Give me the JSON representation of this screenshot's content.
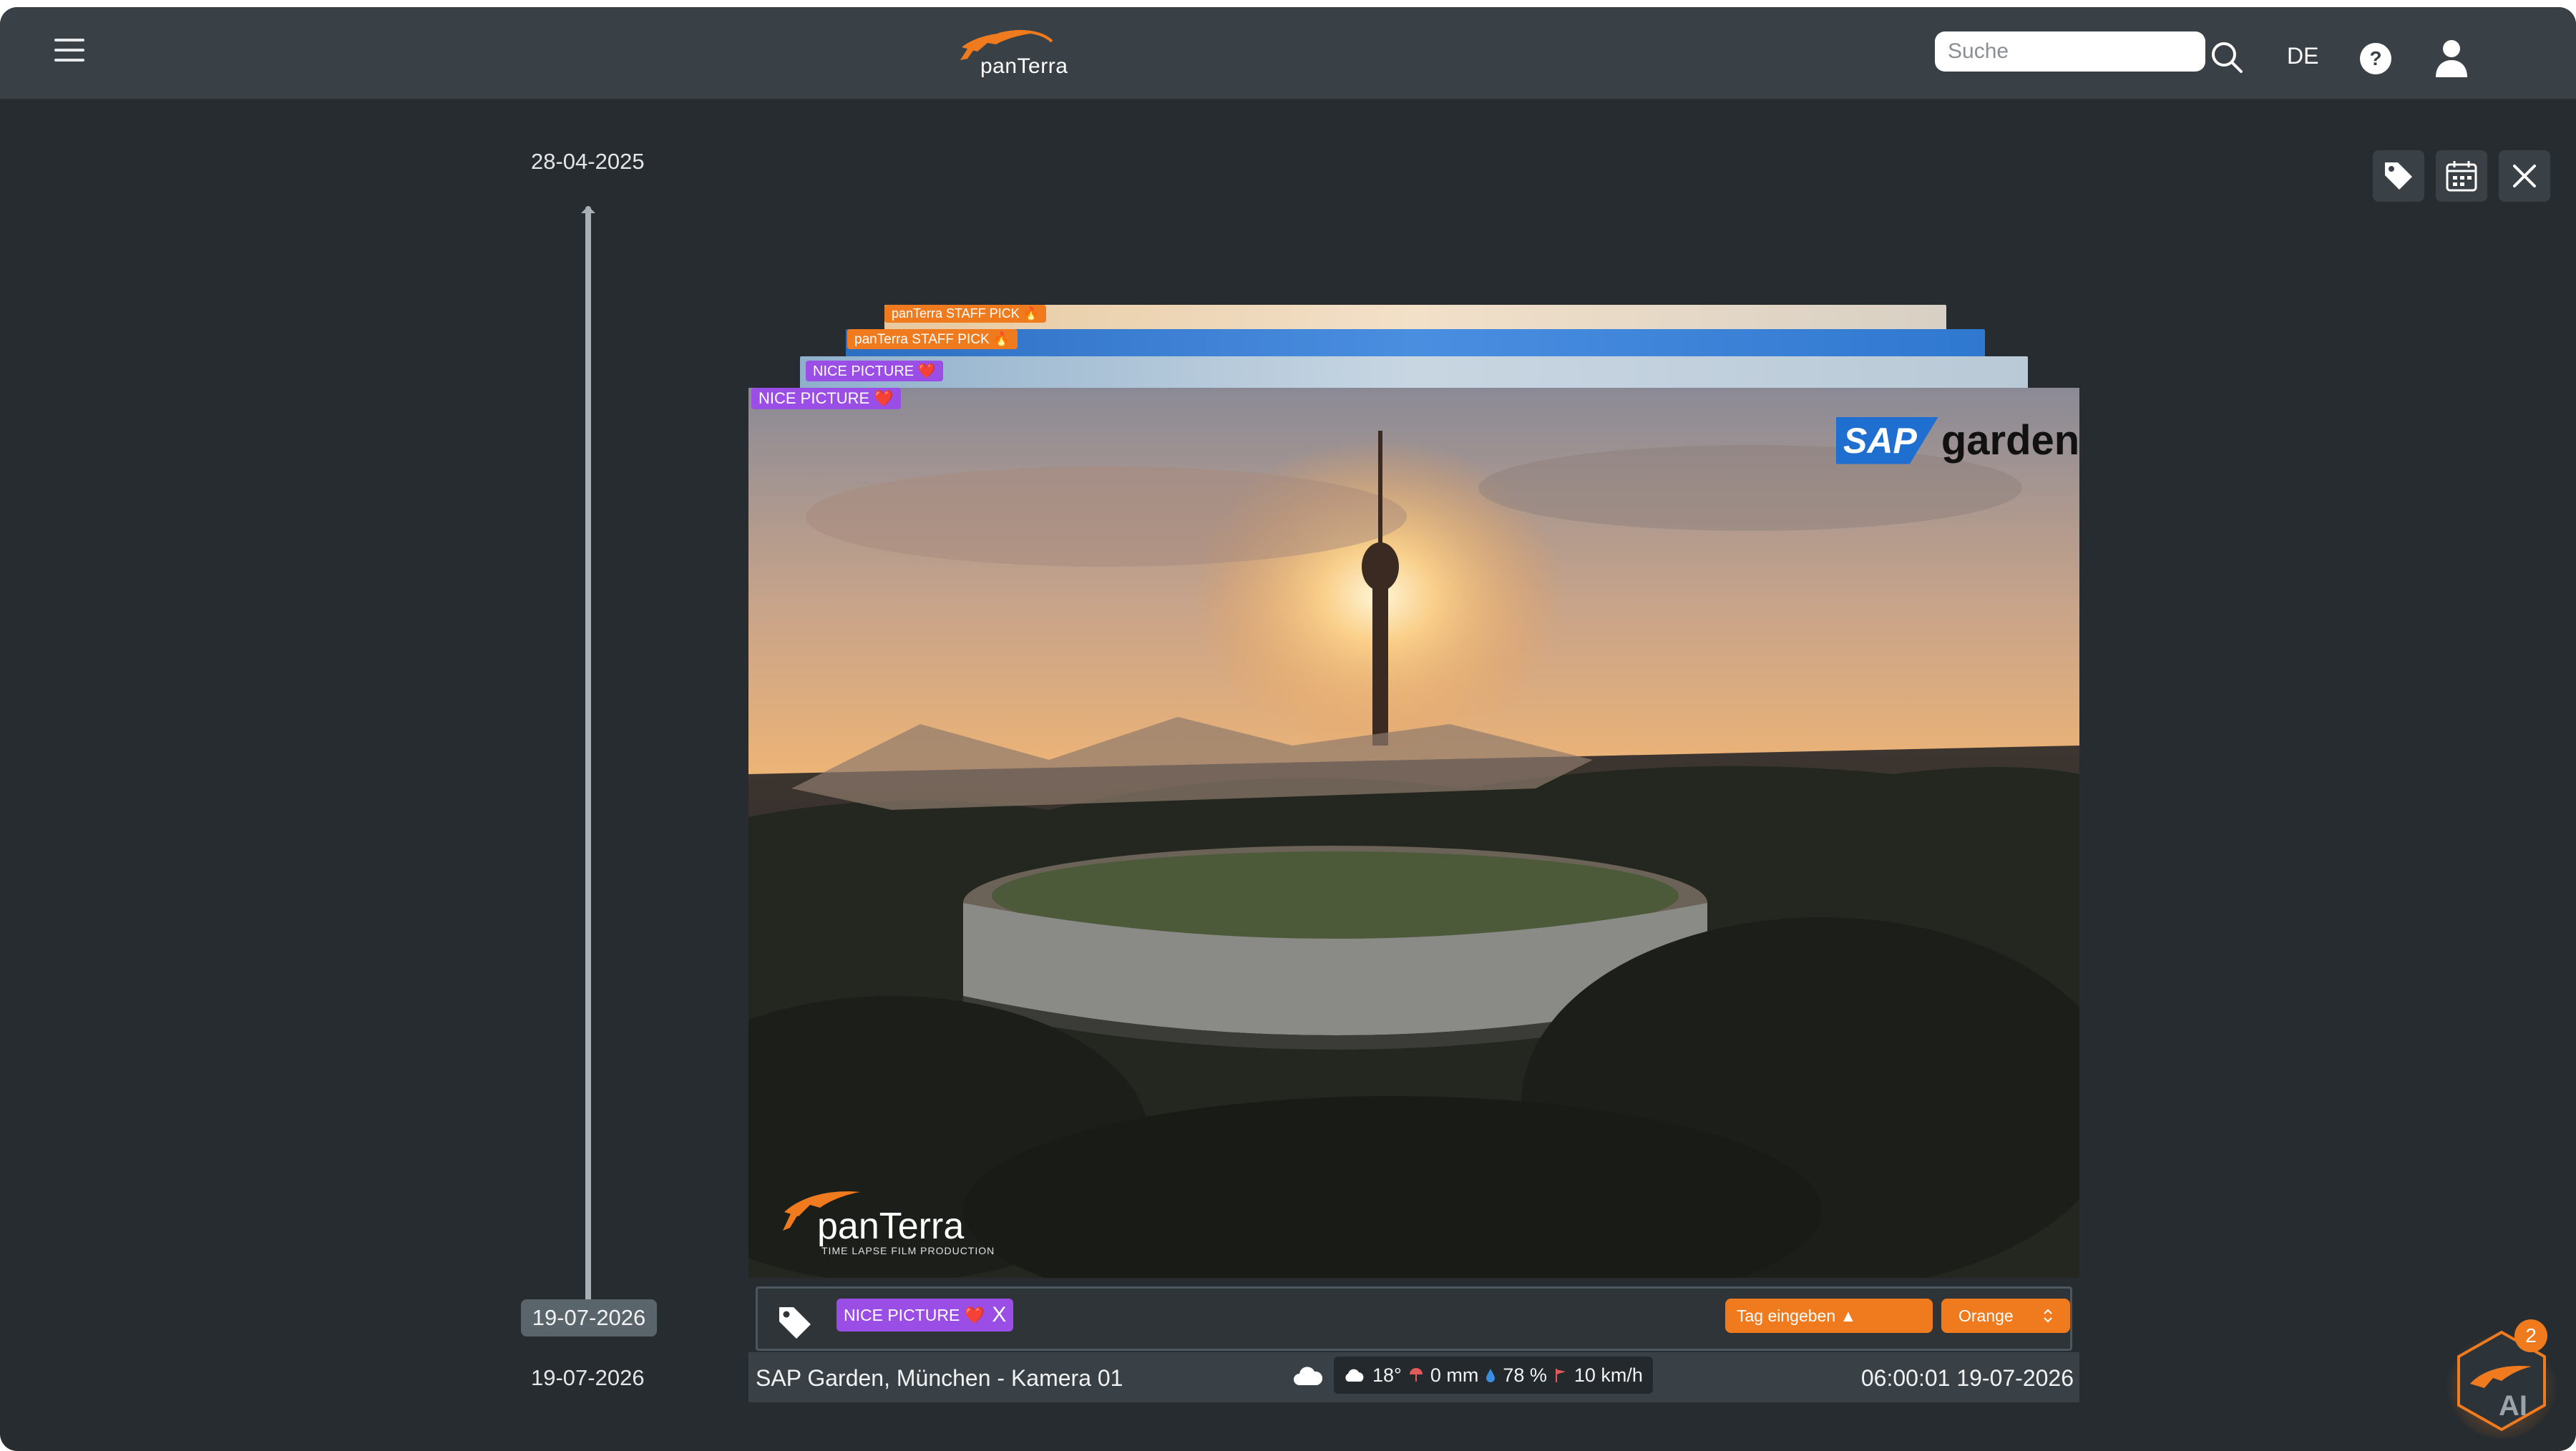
{
  "header": {
    "brand": "panTerra",
    "search_placeholder": "Suche",
    "language": "DE"
  },
  "timeline": {
    "start_date": "28-04-2025",
    "selected_date": "19-07-2026",
    "end_date": "19-07-2026"
  },
  "stacked_images": [
    {
      "tag": "panTerra STAFF PICK 🔥",
      "tag_color": "#f07b1e"
    },
    {
      "tag": "panTerra STAFF PICK 🔥",
      "tag_color": "#f07b1e"
    },
    {
      "tag": "NICE PICTURE ❤️",
      "tag_color": "#9a4ee6"
    },
    {
      "tag": "NICE PICTURE ❤️",
      "tag_color": "#9a4ee6"
    }
  ],
  "photo": {
    "sponsor_sap": "SAP",
    "sponsor_garden": "garden",
    "watermark_name": "panTerra",
    "watermark_sub": "TIME LAPSE FILM PRODUCTION"
  },
  "tag_editor": {
    "chip_label": "NICE PICTURE ❤️",
    "chip_remove": "X",
    "input_placeholder": "Tag eingeben ▲",
    "color_value": "Orange"
  },
  "info": {
    "camera": "SAP Garden, München - Kamera 01",
    "temperature": "18°",
    "rain": "0 mm",
    "humidity": "78 %",
    "wind": "10 km/h",
    "timestamp": "06:00:01 19-07-2026"
  },
  "ai": {
    "label": "AI",
    "badge_count": "2"
  },
  "colors": {
    "accent": "#f07b1e",
    "purple": "#9a4ee6",
    "background": "#272c30",
    "topbar": "#3a4146"
  }
}
